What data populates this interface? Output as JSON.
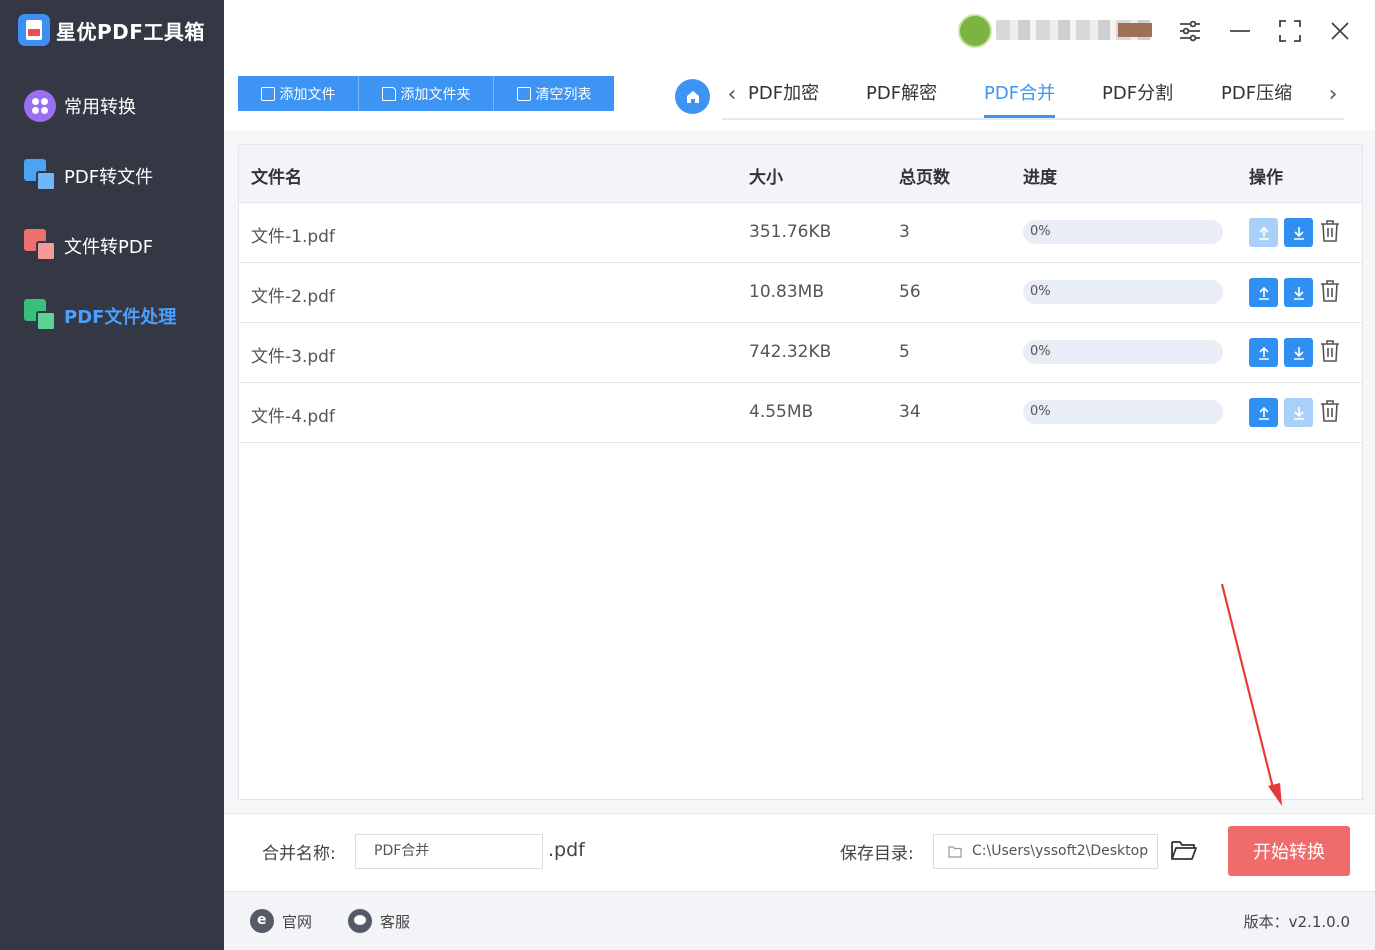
{
  "app": {
    "title": "星优PDF工具箱",
    "version": "版本：v2.1.0.0"
  },
  "sidebar": {
    "items": [
      {
        "label": "常用转换"
      },
      {
        "label": "PDF转文件"
      },
      {
        "label": "文件转PDF"
      },
      {
        "label": "PDF文件处理",
        "active": true
      }
    ]
  },
  "toolbar": {
    "add_file": "添加文件",
    "add_folder": "添加文件夹",
    "clear_list": "清空列表"
  },
  "tabs": [
    {
      "label": "PDF加密"
    },
    {
      "label": "PDF解密"
    },
    {
      "label": "PDF合并",
      "active": true
    },
    {
      "label": "PDF分割"
    },
    {
      "label": "PDF压缩"
    }
  ],
  "table": {
    "headers": {
      "name": "文件名",
      "size": "大小",
      "pages": "总页数",
      "progress": "进度",
      "actions": "操作"
    },
    "rows": [
      {
        "name": "文件-1.pdf",
        "size": "351.76KB",
        "pages": "3",
        "progress": "0%",
        "progress_value": 0,
        "up_enabled": false,
        "down_enabled": true
      },
      {
        "name": "文件-2.pdf",
        "size": "10.83MB",
        "pages": "56",
        "progress": "0%",
        "progress_value": 0,
        "up_enabled": true,
        "down_enabled": true
      },
      {
        "name": "文件-3.pdf",
        "size": "742.32KB",
        "pages": "5",
        "progress": "0%",
        "progress_value": 0,
        "up_enabled": true,
        "down_enabled": true
      },
      {
        "name": "文件-4.pdf",
        "size": "4.55MB",
        "pages": "34",
        "progress": "0%",
        "progress_value": 0,
        "up_enabled": true,
        "down_enabled": false
      }
    ]
  },
  "bottom": {
    "merge_name_label": "合并名称:",
    "merge_name_value": "PDF合并",
    "merge_ext": ".pdf",
    "save_dir_label": "保存目录:",
    "save_dir_value": "C:\\Users\\yssoft2\\Desktop",
    "start_label": "开始转换"
  },
  "footer": {
    "website": "官网",
    "support": "客服"
  },
  "colors": {
    "accent": "#3e94f2",
    "sidebar_bg": "#343744",
    "start_button": "#f06b6b",
    "annotation_arrow": "#e53935"
  }
}
